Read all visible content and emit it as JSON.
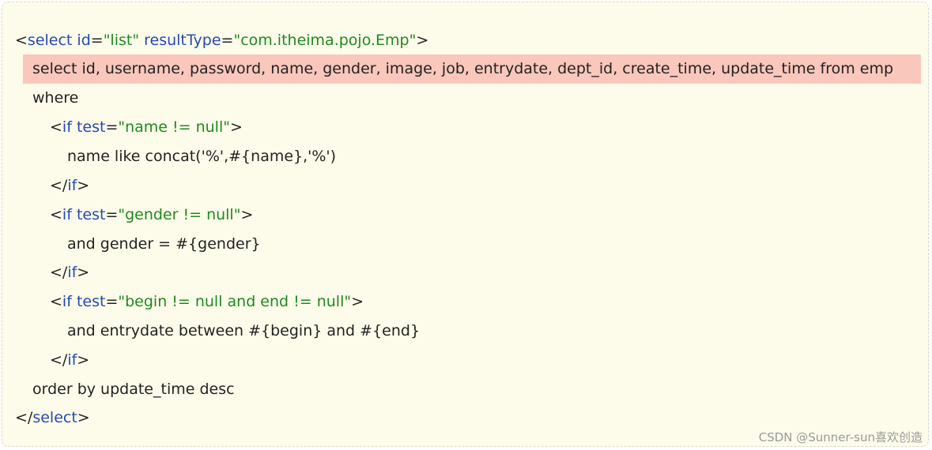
{
  "code": {
    "line1": {
      "lt": "<",
      "tag": "select",
      "attr1": "id",
      "eq1": "=",
      "val1": "\"list\"",
      "attr2": "resultType",
      "eq2": "=",
      "val2": "\"com.itheima.pojo.Emp\"",
      "gt": ">"
    },
    "line2": {
      "text": "select id, username, password, name, gender, image, job, entrydate, dept_id, create_time, update_time from emp"
    },
    "line3": {
      "text": "where"
    },
    "line4": {
      "lt": "<",
      "tag": "if",
      "attr": "test",
      "eq": "=",
      "val": "\"name != null\"",
      "gt": ">"
    },
    "line5": {
      "text": "name like concat('%',#{name},'%')"
    },
    "line6": {
      "open": "</",
      "tag": "if",
      "gt": ">"
    },
    "line7": {
      "lt": "<",
      "tag": "if",
      "attr": "test",
      "eq": "=",
      "val": "\"gender != null\"",
      "gt": ">"
    },
    "line8": {
      "text": "and gender = #{gender}"
    },
    "line9": {
      "open": "</",
      "tag": "if",
      "gt": ">"
    },
    "line10": {
      "lt": "<",
      "tag": "if",
      "attr": "test",
      "eq": "=",
      "val": "\"begin != null and end != null\"",
      "gt": ">"
    },
    "line11": {
      "text": "and entrydate between #{begin} and #{end}"
    },
    "line12": {
      "open": "</",
      "tag": "if",
      "gt": ">"
    },
    "line13": {
      "text": "order by update_time desc"
    },
    "line14": {
      "open": "</",
      "tag": "select",
      "gt": ">"
    }
  },
  "watermark": "CSDN @Sunner-sun喜欢创造"
}
